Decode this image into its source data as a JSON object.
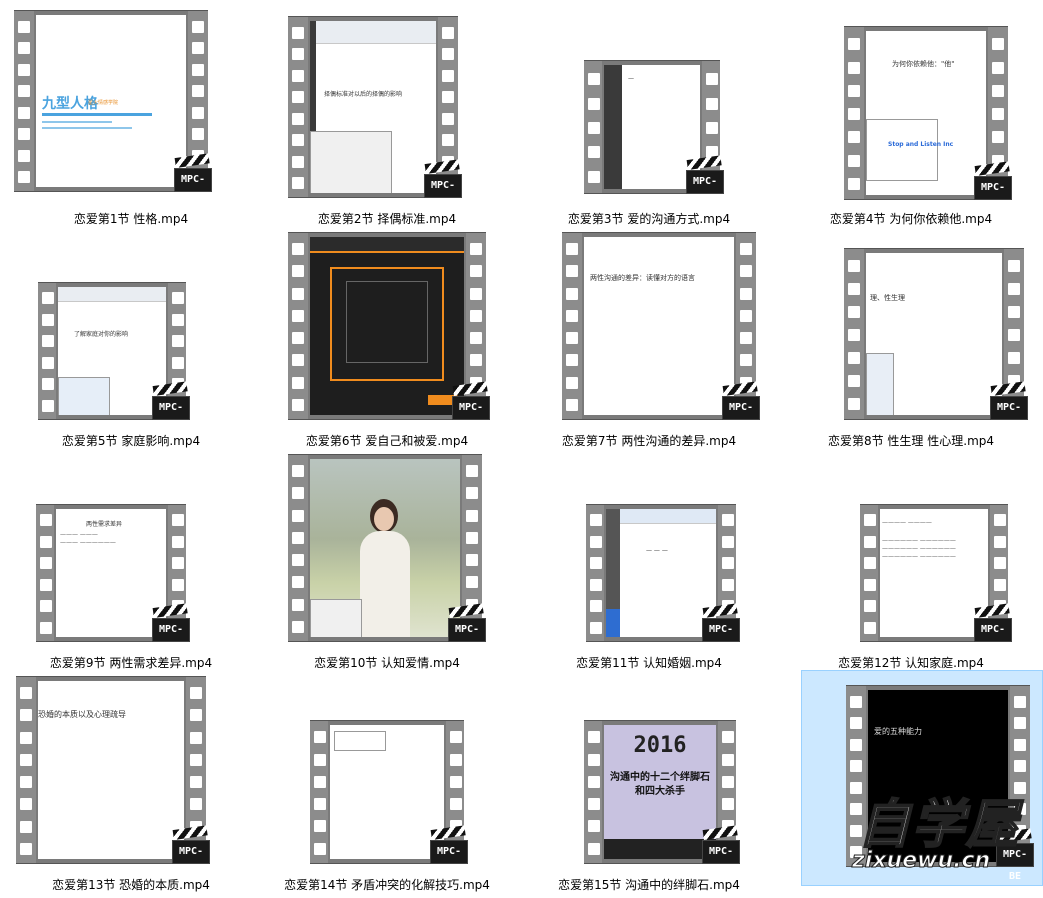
{
  "files": [
    {
      "name": "恋爱第1节 性格.mp4",
      "preview_text": "九型人格",
      "preview_sub": "星火情感学院"
    },
    {
      "name": "恋爱第2节 择偶标准.mp4",
      "preview_text": "择偶标准对以后的择偶的影响"
    },
    {
      "name": "恋爱第3节 爱的沟通方式.mp4"
    },
    {
      "name": "恋爱第4节 为何你依赖他.mp4",
      "preview_text": "为何你依赖他：\"他\"",
      "preview_sub": "Stop and Listen Inc"
    },
    {
      "name": "恋爱第5节 家庭影响.mp4",
      "preview_text": "了解家庭对你的影响"
    },
    {
      "name": "恋爱第6节 爱自己和被爱.mp4"
    },
    {
      "name": "恋爱第7节 两性沟通的差异.mp4",
      "preview_text": "两性沟通的差异：读懂对方的语言"
    },
    {
      "name": "恋爱第8节 性生理 性心理.mp4",
      "preview_text": "理、性生理"
    },
    {
      "name": "恋爱第9节 两性需求差异.mp4",
      "preview_text": "两性需求差异"
    },
    {
      "name": "恋爱第10节 认知爱情.mp4"
    },
    {
      "name": "恋爱第11节 认知婚姻.mp4"
    },
    {
      "name": "恋爱第12节 认知家庭.mp4"
    },
    {
      "name": "恋爱第13节 恐婚的本质.mp4",
      "preview_text": "恐婚的本质以及心理疏导"
    },
    {
      "name": "恋爱第14节 矛盾冲突的化解技巧.mp4"
    },
    {
      "name": "恋爱第15节 沟通中的绊脚石.mp4",
      "preview_year": "2016",
      "preview_text": "沟通中的十二个绊脚石和四大杀手"
    },
    {
      "name": "",
      "preview_text": "爱的五种能力"
    }
  ],
  "badge_label": "MPC-BE",
  "watermark": {
    "top": "自学屋",
    "bottom": "zixuewu.cn"
  },
  "colors": {
    "selection": "#cce8ff",
    "selection_border": "#99d1ff",
    "film": "#7a7a7a"
  }
}
